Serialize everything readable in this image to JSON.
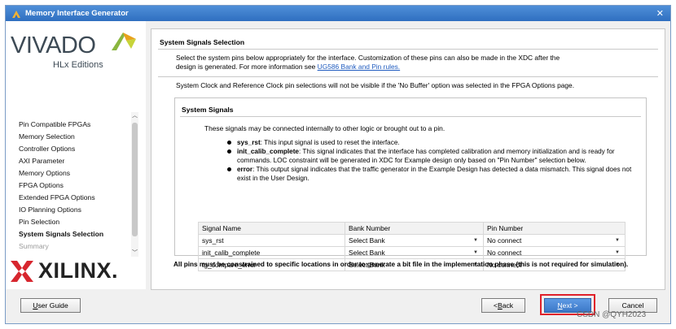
{
  "window": {
    "title": "Memory Interface Generator",
    "close_glyph": "✕"
  },
  "branding": {
    "vivado": "VIVADO",
    "vivado_edition": "HLx Editions",
    "xilinx": "XILINX.",
    "accent_color": "#e8a21c"
  },
  "sidebar": {
    "items": [
      {
        "label": "Pin Compatible FPGAs"
      },
      {
        "label": "Memory Selection"
      },
      {
        "label": "Controller Options"
      },
      {
        "label": "AXI Parameter"
      },
      {
        "label": "Memory Options"
      },
      {
        "label": "FPGA Options"
      },
      {
        "label": "Extended FPGA Options"
      },
      {
        "label": "IO Planning Options"
      },
      {
        "label": "Pin Selection"
      },
      {
        "label": "System Signals Selection"
      },
      {
        "label": "Summary"
      }
    ],
    "active_index": 9
  },
  "main": {
    "section_title": "System Signals Selection",
    "intro_line1": "Select the system pins below appropriately for the interface. Customization of these pins can also be made in the XDC after the",
    "intro_line2_prefix": "design is generated. For more information see ",
    "intro_link": "UG586 Bank and Pin rules.",
    "clock_note": "System Clock and Reference Clock pin selections will not be visible if the 'No Buffer' option was selected in the FPGA Options page.",
    "system_signals": {
      "title": "System Signals",
      "intro": "These signals may be connected internally to other logic or brought out to a pin.",
      "bullets": [
        {
          "name": "sys_rst",
          "text": ": This input signal is used to reset the interface."
        },
        {
          "name": "init_calib_complete",
          "text": ": This signal indicates that the interface has completed calibration and memory initialization and is ready for commands. LOC constraint will be generated in XDC for Example design only based on \"Pin Number\" selection below."
        },
        {
          "name": "error",
          "text": ": This output signal indicates that the traffic generator in the Example Design has detected a data mismatch. This signal does not exist in the User Design."
        }
      ],
      "table": {
        "headers": [
          "Signal Name",
          "Bank Number",
          "Pin Number"
        ],
        "rows": [
          {
            "signal": "sys_rst",
            "bank": "Select Bank",
            "pin": "No connect"
          },
          {
            "signal": "init_calib_complete",
            "bank": "Select Bank",
            "pin": "No connect"
          },
          {
            "signal": "tg_compare_error",
            "bank": "Select Bank",
            "pin": "No connect"
          }
        ]
      }
    },
    "footnote": "All pins must be constrained to specific locations in order to generate a bit file in the implementation phase (this is not required for simulation)."
  },
  "buttons": {
    "user_guide": "User Guide",
    "back": "< Back",
    "next": "Next >",
    "cancel": "Cancel"
  },
  "watermark": "CSDN @QYH2023"
}
